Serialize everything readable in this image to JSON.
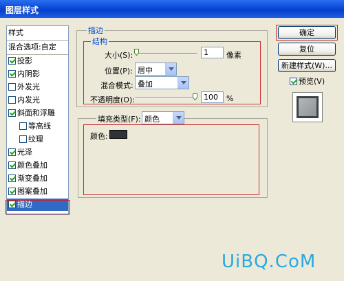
{
  "window": {
    "title": "图层样式"
  },
  "sidebar": {
    "header": "样式",
    "blend_options": "混合选项:自定",
    "items": [
      {
        "label": "投影",
        "checked": true
      },
      {
        "label": "内阴影",
        "checked": true
      },
      {
        "label": "外发光",
        "checked": false
      },
      {
        "label": "内发光",
        "checked": false
      },
      {
        "label": "斜面和浮雕",
        "checked": true
      },
      {
        "label": "等高线",
        "checked": false
      },
      {
        "label": "纹理",
        "checked": false
      },
      {
        "label": "光泽",
        "checked": true
      },
      {
        "label": "颜色叠加",
        "checked": true
      },
      {
        "label": "渐变叠加",
        "checked": true
      },
      {
        "label": "图案叠加",
        "checked": true
      },
      {
        "label": "描边",
        "checked": true,
        "selected": true
      }
    ]
  },
  "stroke": {
    "group_title": "描边",
    "structure_title": "结构",
    "size_label": "大小(S):",
    "size_value": "1",
    "size_unit": "像素",
    "position_label": "位置(P):",
    "position_value": "居中",
    "blend_label": "混合模式:",
    "blend_value": "叠加",
    "opacity_label": "不透明度(O):",
    "opacity_value": "100",
    "opacity_unit": "%",
    "size_slider_fraction": 0.0,
    "opacity_slider_fraction": 1.0
  },
  "fill": {
    "type_label": "填充类型(F):",
    "type_value": "颜色",
    "color_label": "颜色:",
    "color": "#2f3338"
  },
  "buttons": {
    "ok": "确定",
    "reset": "复位",
    "new_style": "新建样式(W)...",
    "preview_label": "预览(V)",
    "preview_checked": true
  },
  "watermark": "UiBQ.CoM"
}
